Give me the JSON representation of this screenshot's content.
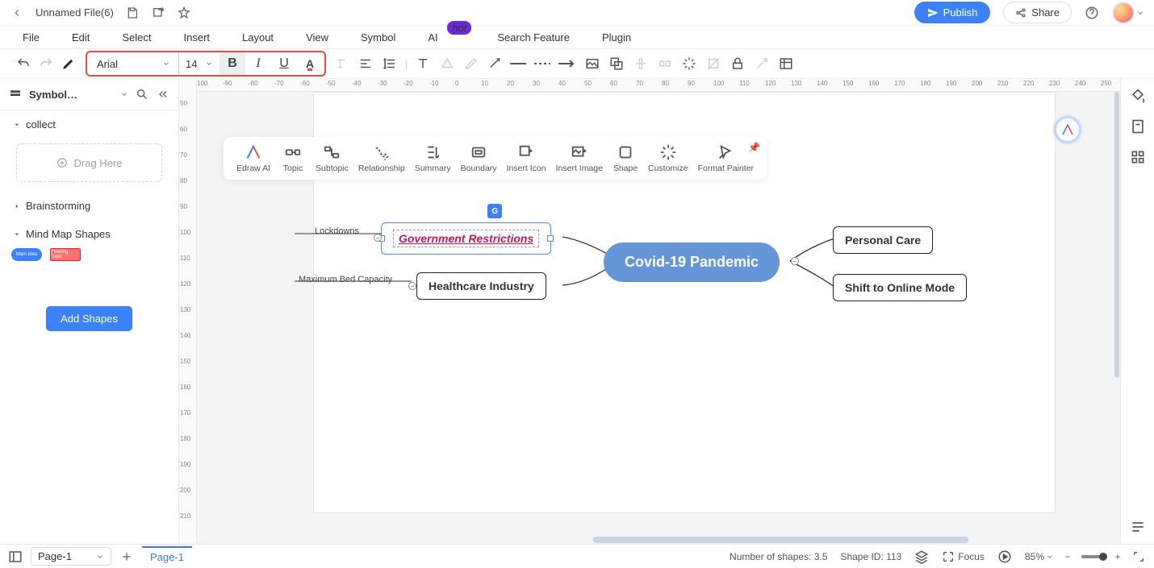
{
  "file": {
    "title": "Unnamed File(6)"
  },
  "topbar": {
    "publish": "Publish",
    "share": "Share"
  },
  "menubar": {
    "file": "File",
    "edit": "Edit",
    "select": "Select",
    "insert": "Insert",
    "layout": "Layout",
    "view": "View",
    "symbol": "Symbol",
    "ai": "AI",
    "ai_badge": "hot",
    "search": "Search Feature",
    "plugin": "Plugin"
  },
  "toolbar": {
    "font_name": "Arial",
    "font_size": "14",
    "bold": "B",
    "italic": "I",
    "underline": "U",
    "color": "A"
  },
  "sidebar": {
    "title": "Symbol…",
    "sections": {
      "collect": "collect",
      "brainstorming": "Brainstorming",
      "mindmap": "Mind Map Shapes"
    },
    "drag_here": "Drag Here",
    "add_shapes": "Add Shapes"
  },
  "ruler_top": [
    "100",
    "-90",
    "-80",
    "-70",
    "-60",
    "-50",
    "-40",
    "-30",
    "-20",
    "-10",
    "0",
    "10",
    "20",
    "30",
    "40",
    "50",
    "60",
    "70",
    "80",
    "90",
    "100",
    "110",
    "120",
    "130",
    "140",
    "150",
    "160",
    "170",
    "180",
    "190",
    "200",
    "210",
    "220",
    "230",
    "240",
    "250"
  ],
  "ruler_left": [
    "50",
    "60",
    "70",
    "80",
    "90",
    "100",
    "110",
    "120",
    "130",
    "140",
    "150",
    "160",
    "170",
    "180",
    "190",
    "200",
    "210"
  ],
  "float_toolbar": {
    "items": [
      "Edraw AI",
      "Topic",
      "Subtopic",
      "Relationship",
      "Summary",
      "Boundary",
      "Insert Icon",
      "Insert Image",
      "Shape",
      "Customize",
      "Format Painter"
    ]
  },
  "mindmap": {
    "center": "Covid-19 Pandemic",
    "gov": "Government Restrictions",
    "gov_sub": "Lockdowns",
    "health": "Healthcare Industry",
    "health_sub": "Maximum Bed Capacity",
    "personal": "Personal Care",
    "shift": "Shift to Online Mode",
    "g_badge": "G"
  },
  "statusbar": {
    "page_label": "Page-1",
    "page_tab": "Page-1",
    "shapes": "Number of shapes: 3.5",
    "shape_id": "Shape ID: 113",
    "focus": "Focus",
    "zoom": "85%"
  }
}
